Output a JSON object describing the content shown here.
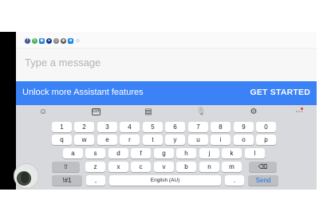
{
  "status_icons": [
    {
      "name": "facebook-icon",
      "color": "#3b5998"
    },
    {
      "name": "refresh-icon",
      "color": "#4caf50"
    },
    {
      "name": "app-icon",
      "color": "#1976d2"
    },
    {
      "name": "messenger-icon",
      "color": "#0b3d91"
    },
    {
      "name": "app2-icon",
      "color": "#7b7b7b"
    },
    {
      "name": "app3-icon",
      "color": "#555555"
    },
    {
      "name": "bag-icon",
      "color": "#1e88e5"
    },
    {
      "name": "grid-icon",
      "color": "#1565c0"
    }
  ],
  "message": {
    "placeholder": "Type a message"
  },
  "banner": {
    "text": "Unlock more Assistant features",
    "button": "GET STARTED",
    "color": "#3b82f6"
  },
  "toolbar": {
    "icons": [
      "emoji-icon",
      "gif-icon",
      "sticker-icon",
      "mic-icon",
      "settings-icon",
      "more-icon"
    ],
    "gif_label": "GIF"
  },
  "keyboard": {
    "numbers": [
      "1",
      "2",
      "3",
      "4",
      "5",
      "6",
      "7",
      "8",
      "9",
      "0"
    ],
    "row1": [
      "q",
      "w",
      "e",
      "r",
      "t",
      "y",
      "u",
      "i",
      "o",
      "p"
    ],
    "row2": [
      "a",
      "s",
      "d",
      "f",
      "g",
      "h",
      "j",
      "k",
      "l"
    ],
    "row3": [
      "z",
      "x",
      "c",
      "v",
      "b",
      "n",
      "m"
    ],
    "symbols_label": "!#1",
    "comma_label": ",",
    "space_label": "English (AU)",
    "period_label": ".",
    "send_label": "Send"
  }
}
